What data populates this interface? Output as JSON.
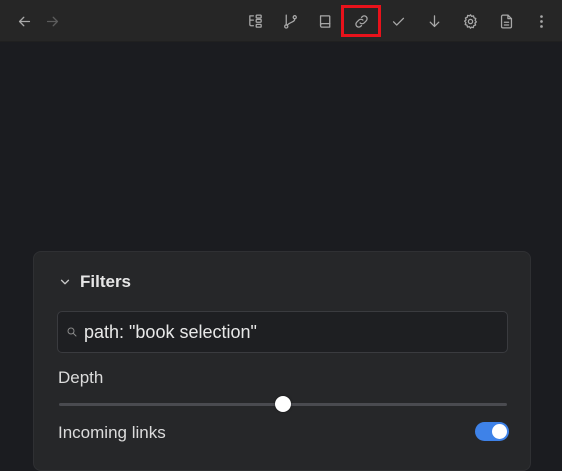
{
  "toolbar": {
    "back_icon": "arrow-left-icon",
    "forward_icon": "arrow-right-icon",
    "tools": [
      {
        "name": "tree-icon"
      },
      {
        "name": "git-branch-icon"
      },
      {
        "name": "book-icon"
      },
      {
        "name": "link-icon",
        "highlighted": true
      },
      {
        "name": "check-icon"
      },
      {
        "name": "arrow-down-icon"
      },
      {
        "name": "gear-icon"
      },
      {
        "name": "document-icon"
      },
      {
        "name": "more-vertical-icon"
      }
    ],
    "highlight_color": "#e8121b"
  },
  "filters": {
    "title": "Filters",
    "search_value": "path: \"book selection\"",
    "depth_label": "Depth",
    "depth_value": 0.5,
    "incoming_links_label": "Incoming links",
    "incoming_links_enabled": true,
    "toggle_color": "#3e82e8"
  }
}
